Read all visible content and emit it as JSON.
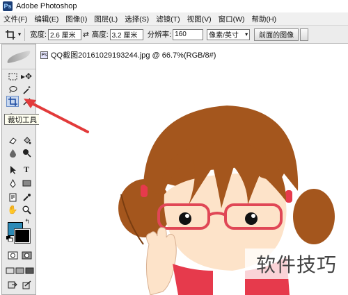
{
  "window": {
    "title": "Adobe Photoshop",
    "logo_text": "Ps"
  },
  "menu": [
    "文件(F)",
    "编辑(E)",
    "图像(I)",
    "图层(L)",
    "选择(S)",
    "滤镜(T)",
    "视图(V)",
    "窗口(W)",
    "帮助(H)"
  ],
  "options": {
    "width_label": "宽度:",
    "width_value": "2.6 厘米",
    "swap_icon": "⇄",
    "height_label": "高度:",
    "height_value": "3.2 厘米",
    "resolution_label": "分辨率:",
    "resolution_value": "160",
    "unit_value": "像素/英寸",
    "front_image_label": "前面的图像"
  },
  "document": {
    "title": "QQ截图20161029193244.jpg @ 66.7%(RGB/8#)"
  },
  "tooltip": "裁切工具 (C)",
  "colors": {
    "foreground": "#2d8ab6",
    "background": "#000000",
    "annotation_arrow": "#e23a3a"
  },
  "watermark": "软件技巧"
}
